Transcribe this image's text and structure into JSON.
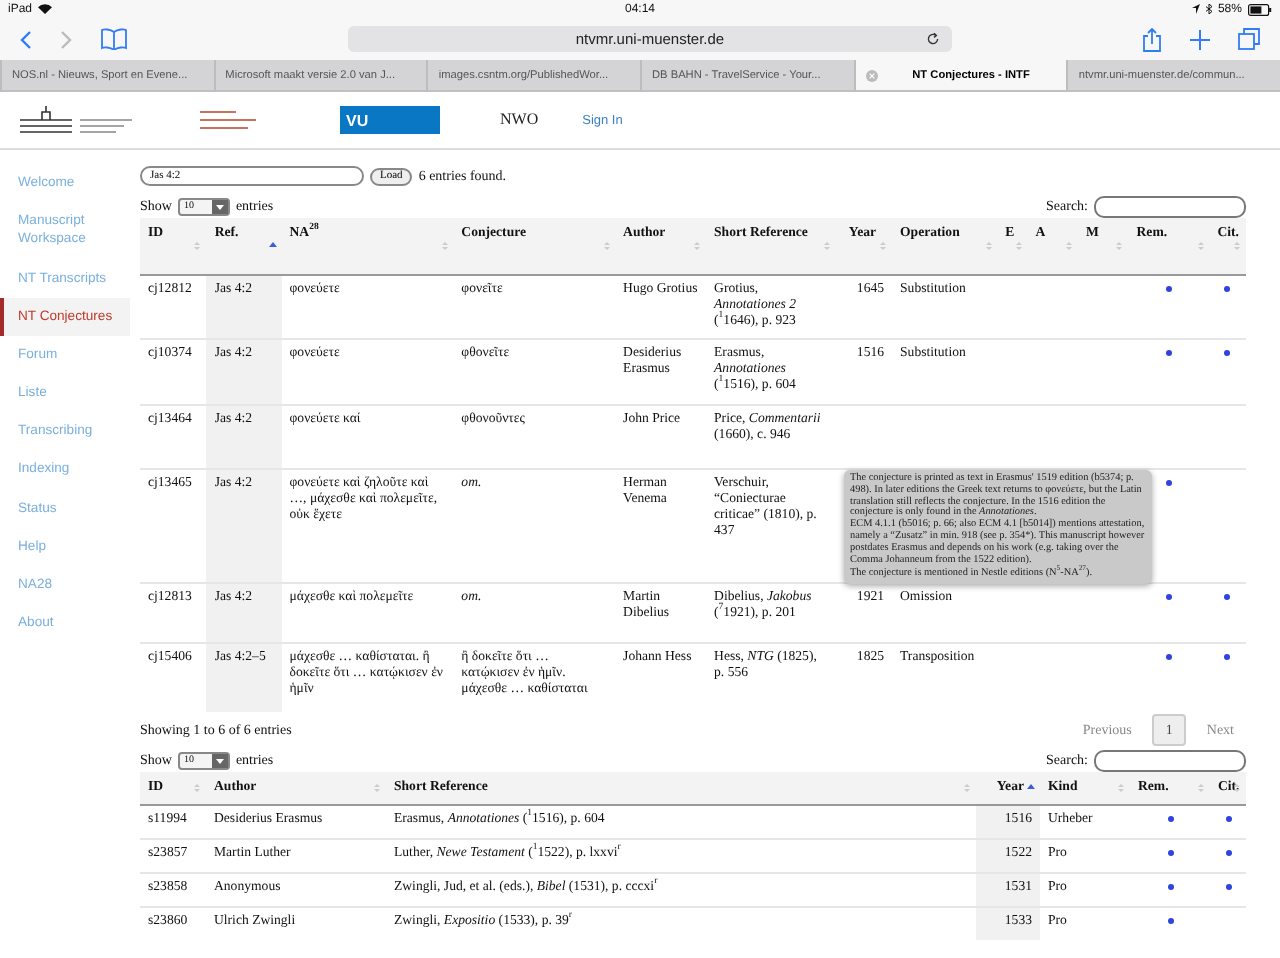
{
  "status_bar": {
    "device": "iPad",
    "time": "04:14",
    "battery": "58%"
  },
  "browser": {
    "url": "ntvmr.uni-muenster.de",
    "tabs": [
      {
        "label": "NOS.nl - Nieuws, Sport en Evene...",
        "selected": false
      },
      {
        "label": "Microsoft maakt versie 2.0 van J...",
        "selected": false
      },
      {
        "label": "images.csntm.org/PublishedWor...",
        "selected": false
      },
      {
        "label": "DB BAHN - TravelService - Your...",
        "selected": false
      },
      {
        "label": "NT Conjectures - INTF",
        "selected": true
      },
      {
        "label": "ntvmr.uni-muenster.de/commun...",
        "selected": false
      }
    ]
  },
  "header": {
    "vu_logo": "VU",
    "nwo_logo": "NWO",
    "sign_in": "Sign In"
  },
  "sidebar": {
    "items": [
      {
        "label": "Welcome",
        "selected": false
      },
      {
        "label": "Manuscript Workspace",
        "selected": false
      },
      {
        "label": "NT Transcripts",
        "selected": false
      },
      {
        "label": "NT Conjectures",
        "selected": true
      },
      {
        "label": "Forum",
        "selected": false
      },
      {
        "label": "Liste",
        "selected": false
      },
      {
        "label": "Transcribing",
        "selected": false
      },
      {
        "label": "Indexing",
        "selected": false
      },
      {
        "label": "Status",
        "selected": false
      },
      {
        "label": "Help",
        "selected": false
      },
      {
        "label": "NA28",
        "selected": false
      },
      {
        "label": "About",
        "selected": false
      }
    ]
  },
  "search": {
    "value": "Jas 4:2",
    "button": "Load",
    "result": "6 entries found."
  },
  "conjectures": {
    "length_menu": {
      "prefix": "Show",
      "value": "10",
      "suffix": "entries"
    },
    "search_label": "Search:",
    "columns": [
      {
        "label": "ID",
        "sorted": false
      },
      {
        "label": "Ref.",
        "sorted": true
      },
      {
        "label": "NA$^{28}$",
        "sorted": false
      },
      {
        "label": "Conjecture",
        "sorted": false
      },
      {
        "label": "Author",
        "sorted": false
      },
      {
        "label": "Short Reference",
        "sorted": false
      },
      {
        "label": "Year",
        "sorted": false
      },
      {
        "label": "Operation",
        "sorted": false
      },
      {
        "label": "E",
        "sorted": false
      },
      {
        "label": "A",
        "sorted": false
      },
      {
        "label": "M",
        "sorted": false
      },
      {
        "label": "Rem.",
        "sorted": false
      },
      {
        "label": "Cit.",
        "sorted": false
      }
    ],
    "rows": [
      {
        "id": "cj12812",
        "ref": "Jas 4:2",
        "na": "φονεύετε",
        "conjecture": "φονεῖτε",
        "conjecture_italic": false,
        "author": "Hugo Grotius",
        "short_reference": "Grotius, *Annotationes 2* ($^{1}$1646), p. 923",
        "year": "1645",
        "operation": "Substitution",
        "rem": true,
        "cit": true
      },
      {
        "id": "cj10374",
        "ref": "Jas 4:2",
        "na": "φονεύετε",
        "conjecture": "φθονεῖτε",
        "conjecture_italic": false,
        "author": "Desiderius Erasmus",
        "short_reference": "Erasmus, *Annotationes* ($^{1}$1516), p. 604",
        "year": "1516",
        "operation": "Substitution",
        "rem": true,
        "cit": true
      },
      {
        "id": "cj13464",
        "ref": "Jas 4:2",
        "na": "φονεύετε καί",
        "conjecture": "φθονοῦντες",
        "conjecture_italic": false,
        "author": "John Price",
        "short_reference": "Price, *Commentarii* (1660), c. 946"
      },
      {
        "id": "cj13465",
        "ref": "Jas 4:2",
        "na": "φονεύετε καὶ ζηλοῦτε καὶ …, μάχεσθε καὶ πολεμεῖτε, οὐκ ἔχετε",
        "conjecture": "om.",
        "conjecture_italic": true,
        "author": "Herman Venema",
        "short_reference": "Verschuir, “Coniecturae criticae” (1810), p. 437",
        "rem": true
      },
      {
        "id": "cj12813",
        "ref": "Jas 4:2",
        "na": "μάχεσθε καὶ πολεμεῖτε",
        "conjecture": "om.",
        "conjecture_italic": true,
        "author": "Martin Dibelius",
        "short_reference": "Dibelius, *Jakobus* ($^{7}$1921), p. 201",
        "year": "1921",
        "operation": "Omission",
        "rem": true,
        "cit": true
      },
      {
        "id": "cj15406",
        "ref": "Jas 4:2–5",
        "na": "μάχεσθε … καθίσταται. ἢ δοκεῖτε ὅτι … κατῴκισεν ἐν ἡμῖν",
        "conjecture": "ἢ δοκεῖτε ὅτι … κατῴκισεν ἐν ἡμῖν. μάχεσθε … καθίσταται",
        "conjecture_italic": false,
        "author": "Johann Hess",
        "short_reference": "Hess, *NTG* (1825), p. 556",
        "year": "1825",
        "operation": "Transposition",
        "rem": true,
        "cit": true
      }
    ],
    "info": "Showing 1 to 6 of 6 entries",
    "pagination": {
      "previous": "Previous",
      "pages": [
        {
          "label": "1",
          "selected": true
        }
      ],
      "next": "Next"
    }
  },
  "tooltip": {
    "paragraphs": [
      "The conjecture is printed as text in Erasmus' 1519 edition (b5374; p. 498). In later editions the Greek text returns to φονεύετε, but the Latin translation still reflects the conjecture. In the 1516 edition the conjecture is only found in the *Annotationes*.",
      "ECM 4.1.1 (b5016; p. 66; also ECM 4.1 [b5014]) mentions attestation, namely a “Zusatz” in min. 918 (see p. 354*). This manuscript however postdates Erasmus and depends on his work (e.g. taking over the Comma Johanneum from the 1522 edition).",
      "The conjecture is mentioned in Nestle editions (N$^{5}$-NA$^{27}$)."
    ]
  },
  "sources": {
    "length_menu": {
      "prefix": "Show",
      "value": "10",
      "suffix": "entries"
    },
    "search_label": "Search:",
    "columns": [
      {
        "label": "ID",
        "sorted": false
      },
      {
        "label": "Author",
        "sorted": false
      },
      {
        "label": "Short Reference",
        "sorted": false
      },
      {
        "label": "Year",
        "sorted": true
      },
      {
        "label": "Kind",
        "sorted": false
      },
      {
        "label": "Rem.",
        "sorted": false
      },
      {
        "label": "Cit.",
        "sorted": false
      }
    ],
    "rows": [
      {
        "id": "s11994",
        "author": "Desiderius Erasmus",
        "short_reference": "Erasmus, *Annotationes* ($^{1}$1516), p. 604",
        "year": "1516",
        "kind": "Urheber",
        "rem": true,
        "cit": true
      },
      {
        "id": "s23857",
        "author": "Martin Luther",
        "short_reference": "Luther, *Newe Testament* ($^{1}$1522), p. lxxvi$^{r}$",
        "year": "1522",
        "kind": "Pro",
        "rem": true,
        "cit": true
      },
      {
        "id": "s23858",
        "author": "Anonymous",
        "short_reference": "Zwingli, Jud, et al. (eds.), *Bibel* (1531), p. cccxi$^{r}$",
        "year": "1531",
        "kind": "Pro",
        "rem": true,
        "cit": true
      },
      {
        "id": "s23860",
        "author": "Ulrich Zwingli",
        "short_reference": "Zwingli, *Expositio* (1533), p. 39$^{r}$",
        "year": "1533",
        "kind": "Pro",
        "rem": true,
        "cit": false
      }
    ]
  }
}
